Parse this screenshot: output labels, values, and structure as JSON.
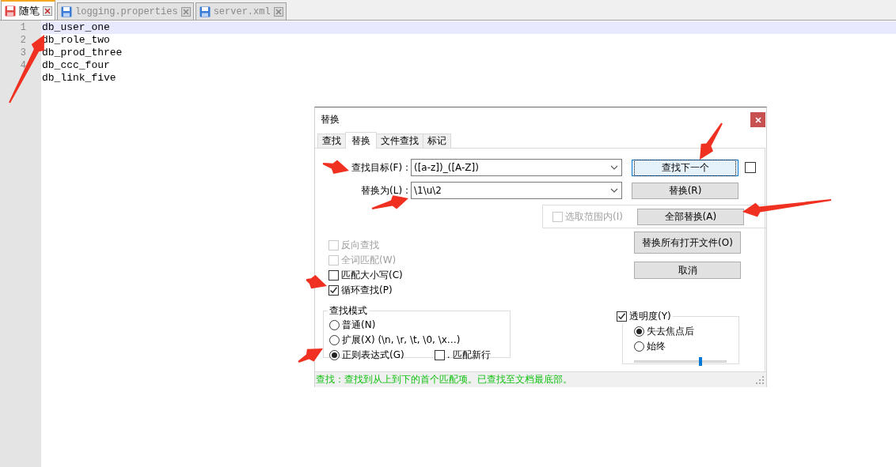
{
  "file_tabs": [
    {
      "label": "随笔",
      "selected": true,
      "modified": true
    },
    {
      "label": "logging.properties",
      "selected": false,
      "modified": false
    },
    {
      "label": "server.xml",
      "selected": false,
      "modified": false
    }
  ],
  "editor": {
    "lines": [
      {
        "number": "1",
        "text": "db_user_one",
        "current": true
      },
      {
        "number": "2",
        "text": "db_role_two",
        "current": false
      },
      {
        "number": "3",
        "text": "db_prod_three",
        "current": false
      },
      {
        "number": "4",
        "text": "db_ccc_four",
        "current": false
      },
      {
        "text": "db_link_five",
        "current": false
      }
    ]
  },
  "dialog": {
    "title": "替换",
    "tabs": [
      {
        "label": "查找",
        "selected": false
      },
      {
        "label": "替换",
        "selected": true
      },
      {
        "label": "文件查找",
        "selected": false
      },
      {
        "label": "标记",
        "selected": false
      }
    ],
    "find_field": {
      "label": "查找目标(F) :",
      "value": "([a-z])_([A-Z])"
    },
    "replace_field": {
      "label": "替换为(L) :",
      "value": "\\1\\u\\2"
    },
    "extra_checkbox": {
      "checked": false
    },
    "in_selection": {
      "label": "选取范围内(I)",
      "checked": false,
      "disabled": true
    },
    "buttons": [
      {
        "label": "查找下一个",
        "focused": true
      },
      {
        "label": "替换(R)",
        "focused": false
      },
      {
        "label": "全部替换(A)",
        "focused": false
      },
      {
        "label": "替换所有打开文件(O)",
        "focused": false
      },
      {
        "label": "取消",
        "focused": false
      }
    ],
    "options": [
      {
        "label": "反向查找",
        "checked": false,
        "disabled": true
      },
      {
        "label": "全词匹配(W)",
        "checked": false,
        "disabled": true
      },
      {
        "label": "匹配大小写(C)",
        "checked": false,
        "disabled": false
      },
      {
        "label": "循环查找(P)",
        "checked": true,
        "disabled": false
      }
    ],
    "search_mode": {
      "title": "查找模式",
      "modes": [
        {
          "label": "普通(N)",
          "selected": false
        },
        {
          "label": "扩展(X) (\\n, \\r, \\t, \\0, \\x…)",
          "selected": false
        },
        {
          "label": "正则表达式(G)",
          "selected": true
        }
      ],
      "dot_newline": {
        "label": ". 匹配新行",
        "checked": false
      }
    },
    "transparency": {
      "label": "透明度(Y)",
      "checked": true,
      "modes": [
        {
          "label": "失去焦点后",
          "selected": true
        },
        {
          "label": "始终",
          "selected": false
        }
      ],
      "level": 0.72
    },
    "status": "查找：查找到从上到下的首个匹配项。已查找至文档最底部。"
  }
}
